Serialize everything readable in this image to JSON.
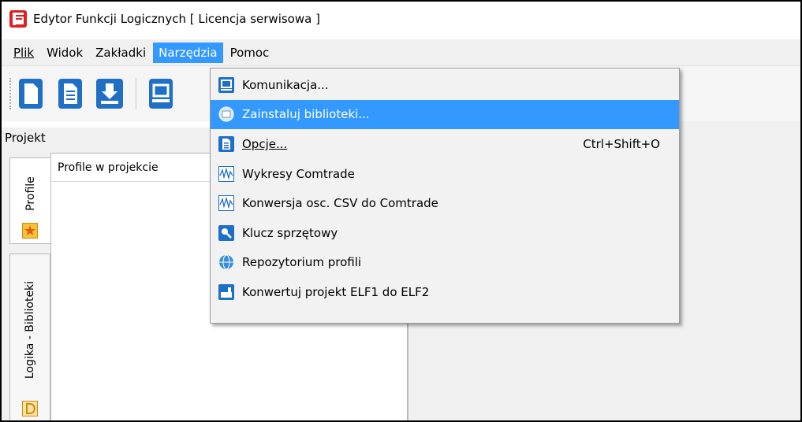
{
  "window": {
    "title": "Edytor Funkcji Logicznych [ Licencja serwisowa ]",
    "app_icon": "edytor-e-icon"
  },
  "menubar": {
    "items": [
      {
        "label": "Plik",
        "active": false
      },
      {
        "label": "Widok",
        "active": false
      },
      {
        "label": "Zakładki",
        "active": false
      },
      {
        "label": "Narzędzia",
        "active": true
      },
      {
        "label": "Pomoc",
        "active": false
      }
    ]
  },
  "toolbar": {
    "icons": [
      "new-document-icon",
      "document-list-icon",
      "download-icon",
      "communication-icon"
    ]
  },
  "project_panel": {
    "title": "Projekt",
    "tabs": [
      {
        "label": "Profile",
        "icon": "profile-star-icon",
        "active": true
      },
      {
        "label": "Logika - Biblioteki",
        "icon": "logic-d-icon",
        "active": false
      }
    ],
    "profiles_header": "Profile w projekcie"
  },
  "dropdown": {
    "items": [
      {
        "label": "Komunikacja...",
        "icon": "communication-icon",
        "shortcut": "",
        "highlighted": false
      },
      {
        "label": "Zainstaluj biblioteki...",
        "icon": "install-libraries-icon",
        "shortcut": "",
        "highlighted": true
      },
      {
        "label": "Opcje...",
        "icon": "options-icon",
        "shortcut": "Ctrl+Shift+O",
        "highlighted": false
      },
      {
        "label": "Wykresy Comtrade",
        "icon": "comtrade-chart-icon",
        "shortcut": "",
        "highlighted": false
      },
      {
        "label": "Konwersja osc. CSV do Comtrade",
        "icon": "csv-convert-icon",
        "shortcut": "",
        "highlighted": false
      },
      {
        "label": "Klucz sprzętowy",
        "icon": "hardware-key-icon",
        "shortcut": "",
        "highlighted": false
      },
      {
        "label": "Repozytorium profili",
        "icon": "repository-globe-icon",
        "shortcut": "",
        "highlighted": false
      },
      {
        "label": "Konwertuj projekt ELF1 do ELF2",
        "icon": "convert-project-icon",
        "shortcut": "",
        "highlighted": false
      }
    ]
  },
  "colors": {
    "menu_highlight": "#3399ff",
    "app_icon_red": "#e02020",
    "icon_blue": "#1f6fc4"
  }
}
